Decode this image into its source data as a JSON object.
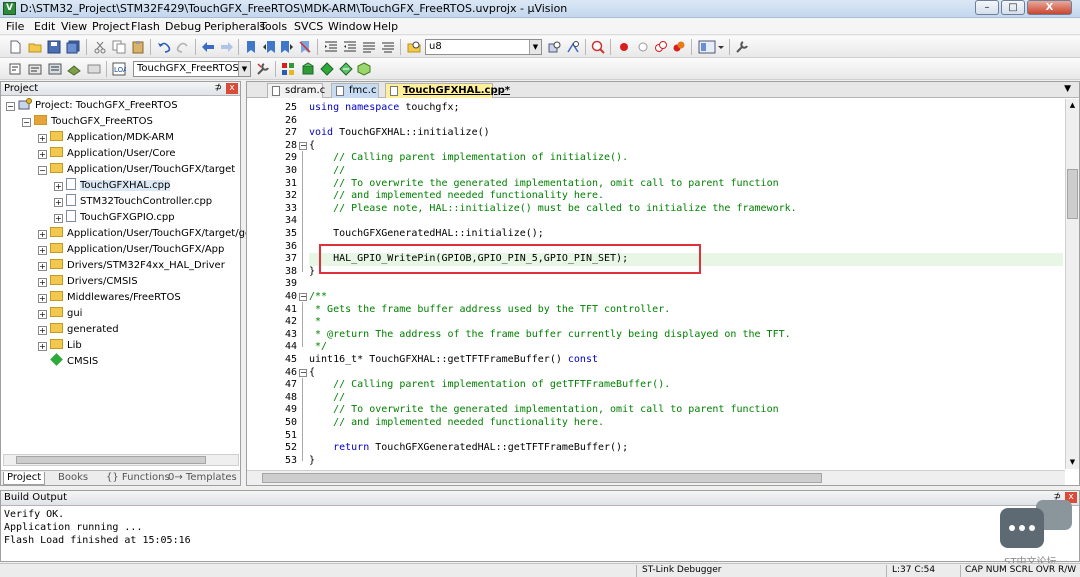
{
  "window": {
    "title": "D:\\STM32_Project\\STM32F429\\TouchGFX_FreeRTOS\\MDK-ARM\\TouchGFX_FreeRTOS.uvprojx - µVision",
    "app_icon": "V",
    "minimize_label": "–",
    "maximize_label": "□",
    "close_label": "X"
  },
  "menu": [
    "File",
    "Edit",
    "View",
    "Project",
    "Flash",
    "Debug",
    "Peripherals",
    "Tools",
    "SVCS",
    "Window",
    "Help"
  ],
  "toolbar": {
    "find_combo_value": "u8",
    "target_combo_value": "TouchGFX_FreeRTOS",
    "combo_arrow": "▼"
  },
  "project_panel": {
    "title": "Project",
    "pin_glyph": "⊅",
    "close_glyph": "x",
    "root_label": "Project: TouchGFX_FreeRTOS",
    "target_label": "TouchGFX_FreeRTOS",
    "items": [
      {
        "label": "Application/MDK-ARM",
        "expander": "+"
      },
      {
        "label": "Application/User/Core",
        "expander": "+"
      },
      {
        "label": "Application/User/TouchGFX/target",
        "expander": "−"
      },
      {
        "label": "TouchGFXHAL.cpp",
        "expander": "+"
      },
      {
        "label": "STM32TouchController.cpp",
        "expander": "+"
      },
      {
        "label": "TouchGFXGPIO.cpp",
        "expander": "+"
      },
      {
        "label": "Application/User/TouchGFX/target/gene",
        "expander": "+"
      },
      {
        "label": "Application/User/TouchGFX/App",
        "expander": "+"
      },
      {
        "label": "Drivers/STM32F4xx_HAL_Driver",
        "expander": "+"
      },
      {
        "label": "Drivers/CMSIS",
        "expander": "+"
      },
      {
        "label": "Middlewares/FreeRTOS",
        "expander": "+"
      },
      {
        "label": "gui",
        "expander": "+"
      },
      {
        "label": "generated",
        "expander": "+"
      },
      {
        "label": "Lib",
        "expander": "+"
      },
      {
        "label": "CMSIS",
        "expander": ""
      }
    ],
    "root_expander": "−",
    "target_expander": "−",
    "tabs": [
      "Project",
      "Books",
      "{} Functions",
      "0→ Templates"
    ]
  },
  "editor": {
    "tabs": [
      "sdram.c",
      "fmc.c",
      "TouchGFXHAL.cpp*"
    ],
    "tab_menu_arrow": "▼",
    "line_numbers": [
      "25",
      "26",
      "27",
      "28",
      "29",
      "30",
      "31",
      "32",
      "33",
      "34",
      "35",
      "36",
      "37",
      "38",
      "39",
      "40",
      "41",
      "42",
      "43",
      "44",
      "45",
      "46",
      "47",
      "48",
      "49",
      "50",
      "51",
      "52",
      "53"
    ],
    "fold_open": "−",
    "lines": [
      {
        "kw": "using namespace",
        "tx": " touchgfx;",
        "cm": ""
      },
      {
        "kw": "",
        "tx": "",
        "cm": ""
      },
      {
        "kw": "void",
        "tx": " TouchGFXHAL::initialize()",
        "cm": ""
      },
      {
        "kw": "",
        "tx": "{",
        "cm": ""
      },
      {
        "kw": "",
        "tx": "    ",
        "cm": "// Calling parent implementation of initialize()."
      },
      {
        "kw": "",
        "tx": "    ",
        "cm": "//"
      },
      {
        "kw": "",
        "tx": "    ",
        "cm": "// To overwrite the generated implementation, omit call to parent function"
      },
      {
        "kw": "",
        "tx": "    ",
        "cm": "// and implemented needed functionality here."
      },
      {
        "kw": "",
        "tx": "    ",
        "cm": "// Please note, HAL::initialize() must be called to initialize the framework."
      },
      {
        "kw": "",
        "tx": "",
        "cm": ""
      },
      {
        "kw": "",
        "tx": "    TouchGFXGeneratedHAL::initialize();",
        "cm": ""
      },
      {
        "kw": "",
        "tx": "",
        "cm": ""
      },
      {
        "kw": "",
        "tx": "    HAL_GPIO_WritePin(GPIOB,GPIO_PIN_5,GPIO_PIN_SET);",
        "cm": ""
      },
      {
        "kw": "",
        "tx": "}",
        "cm": ""
      },
      {
        "kw": "",
        "tx": "",
        "cm": ""
      },
      {
        "kw": "",
        "tx": "",
        "cm": "/**"
      },
      {
        "kw": "",
        "tx": "",
        "cm": " * Gets the frame buffer address used by the TFT controller."
      },
      {
        "kw": "",
        "tx": "",
        "cm": " *"
      },
      {
        "kw": "",
        "tx": "",
        "cm": " * @return The address of the frame buffer currently being displayed on the TFT."
      },
      {
        "kw": "",
        "tx": "",
        "cm": " */"
      },
      {
        "kw": "",
        "tx": "uint16_t* TouchGFXHAL::getTFTFrameBuffer() ",
        "cm": "",
        "kw2": "const"
      },
      {
        "kw": "",
        "tx": "{",
        "cm": ""
      },
      {
        "kw": "",
        "tx": "    ",
        "cm": "// Calling parent implementation of getTFTFrameBuffer()."
      },
      {
        "kw": "",
        "tx": "    ",
        "cm": "//"
      },
      {
        "kw": "",
        "tx": "    ",
        "cm": "// To overwrite the generated implementation, omit call to parent function"
      },
      {
        "kw": "",
        "tx": "    ",
        "cm": "// and implemented needed functionality here."
      },
      {
        "kw": "",
        "tx": "",
        "cm": ""
      },
      {
        "kw": "",
        "tx": "    ",
        "cm": "",
        "kw2": "return",
        "tx2": " TouchGFXGeneratedHAL::getTFTFrameBuffer();"
      },
      {
        "kw": "",
        "tx": "}",
        "cm": ""
      }
    ],
    "scroll_up": "▲",
    "scroll_down": "▼"
  },
  "build_output": {
    "title": "Build Output",
    "lines": [
      "Verify OK.",
      "Application running ...",
      "Flash Load finished at 15:05:16"
    ]
  },
  "watermark": "ST中文论坛",
  "statusbar": {
    "debugger": "ST-Link Debugger",
    "position": "L:37 C:54",
    "indicators": "CAP  NUM  SCRL  OVR  R/W"
  },
  "colors": {
    "keyword": "#0000c8",
    "comment": "#008000",
    "current_line": "#e8f7e5",
    "highlight_box": "#e0303a"
  }
}
